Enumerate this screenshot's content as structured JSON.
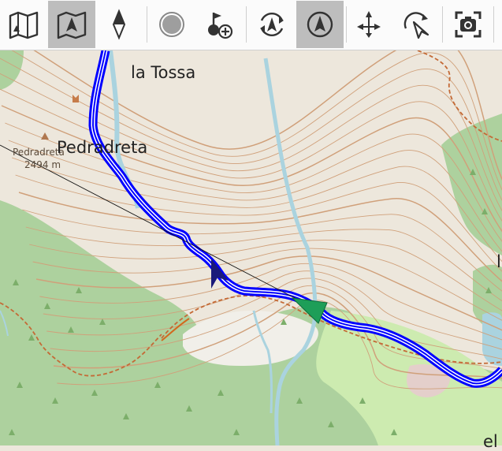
{
  "toolbar": {
    "buttons": [
      {
        "name": "map-icon",
        "active": false
      },
      {
        "name": "map-follow-icon",
        "active": true
      },
      {
        "name": "compass-icon",
        "active": false
      },
      {
        "name": "record-icon",
        "active": false
      },
      {
        "name": "add-waypoint-icon",
        "active": false
      },
      {
        "name": "navigate-auto-icon",
        "active": false
      },
      {
        "name": "navigate-icon",
        "active": true
      },
      {
        "name": "move-icon",
        "active": false
      },
      {
        "name": "route-cursor-icon",
        "active": false
      },
      {
        "name": "screenshot-icon",
        "active": false
      }
    ]
  },
  "map": {
    "labels": {
      "tossa": "la Tossa",
      "peak_name_small": "Pedradreta",
      "peak_name": "Pedradreta",
      "peak_elevation": "2494 m",
      "right_edge_top": "l",
      "right_edge_bottom": "el"
    },
    "colors": {
      "terrain": "#ede7dc",
      "forest": "#add19e",
      "meadow": "#cdebb0",
      "contour": "#d0a07a",
      "stream": "#aad3df",
      "track_outer": "#0000ff",
      "track_inner": "#ffffff",
      "trail": "#d2691e",
      "position_marker": "#1e9e58",
      "direction_arrow": "#1a1a7a"
    }
  }
}
